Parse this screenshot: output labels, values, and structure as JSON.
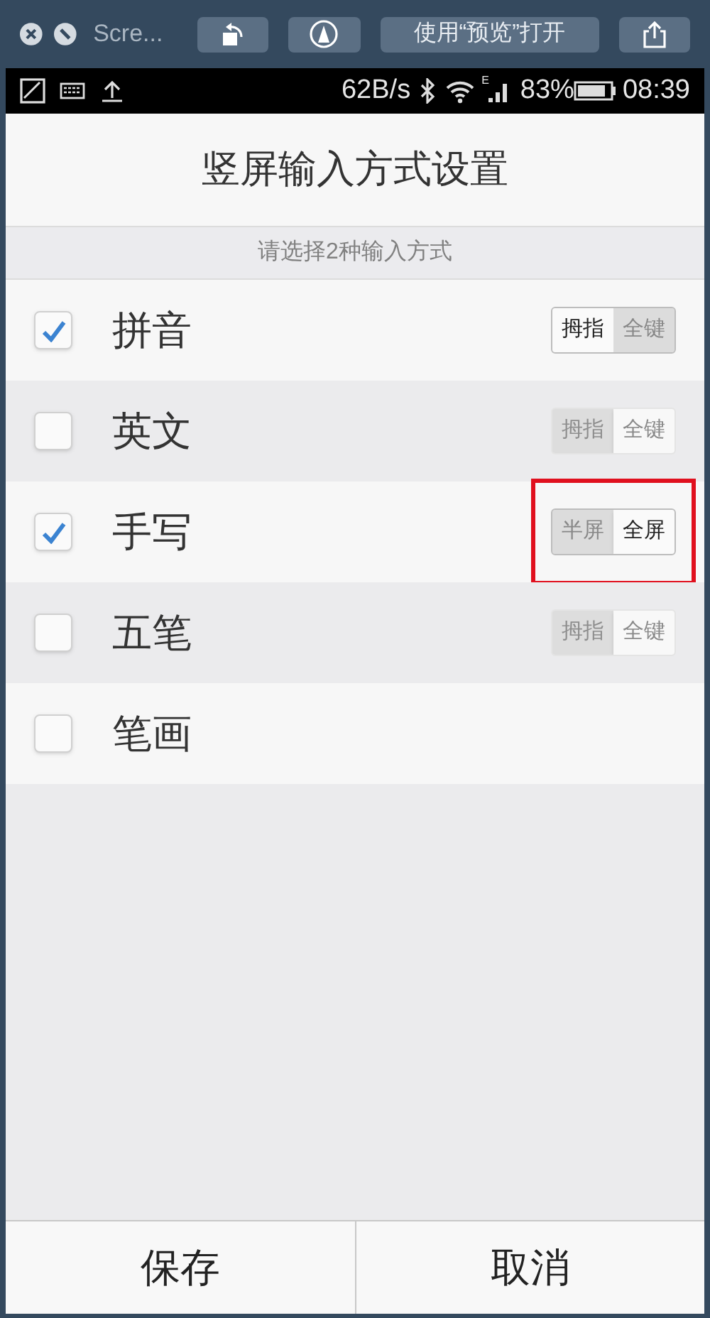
{
  "window": {
    "title": "Scre...",
    "open_with_button": "使用“预览”打开"
  },
  "status_bar": {
    "speed": "62B/s",
    "network_type": "E",
    "battery": "83%",
    "time": "08:39"
  },
  "screen": {
    "title": "竖屏输入方式设置",
    "hint": "请选择2种输入方式"
  },
  "methods": [
    {
      "label": "拼音",
      "checked": true,
      "disabled": false,
      "annotated": false,
      "segments": [
        {
          "label": "拇指",
          "selected": true
        },
        {
          "label": "全键",
          "selected": false
        }
      ]
    },
    {
      "label": "英文",
      "checked": false,
      "disabled": true,
      "annotated": false,
      "segments": [
        {
          "label": "拇指",
          "selected": false
        },
        {
          "label": "全键",
          "selected": true
        }
      ]
    },
    {
      "label": "手写",
      "checked": true,
      "disabled": false,
      "annotated": true,
      "segments": [
        {
          "label": "半屏",
          "selected": false
        },
        {
          "label": "全屏",
          "selected": true
        }
      ]
    },
    {
      "label": "五笔",
      "checked": false,
      "disabled": true,
      "annotated": false,
      "segments": [
        {
          "label": "拇指",
          "selected": false
        },
        {
          "label": "全键",
          "selected": true
        }
      ]
    },
    {
      "label": "笔画",
      "checked": false
    }
  ],
  "buttons": [
    "保存",
    "取消"
  ]
}
